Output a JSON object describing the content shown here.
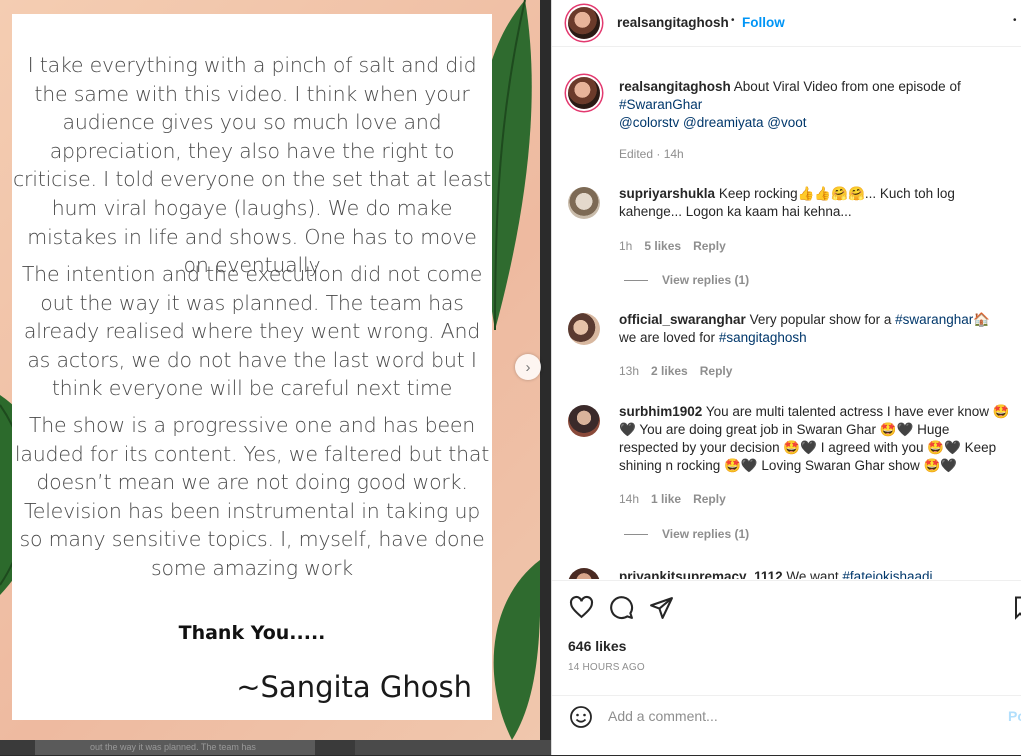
{
  "post": {
    "paragraphs": [
      "I take everything with a pinch of salt and did the same with this video. I think when your audience gives you so much love and appreciation, they also have the right to criticise. I told everyone on the set that at least hum viral hogaye (laughs). We do make mistakes in life and shows. One has to move on eventually",
      "The intention and the execution did not come out the way it was planned. The team has already realised where they went wrong. And as actors, we do not have the last word but I think everyone will be careful next time",
      "The show is a progressive one and has been lauded for its content. Yes, we faltered but that doesn’t mean we are not doing good work. Television has been instrumental in taking up so many sensitive topics. I, myself, have done some amazing work"
    ],
    "thanks": "Thank You.....",
    "signature": "~Sangita Ghosh",
    "next_icon": "chevron-right-icon",
    "strip_text": "out the way it was planned. The team has"
  },
  "header": {
    "username": "realsangitaghosh",
    "dot": "•",
    "follow": "Follow",
    "more": "•"
  },
  "caption": {
    "username": "realsangitaghosh",
    "text": "About Viral Video from one episode of",
    "hashtag": "#SwaranGhar",
    "mentions": [
      "@colorstv",
      "@dreamiyata",
      "@voot"
    ],
    "meta": "Edited · 14h"
  },
  "comments": [
    {
      "username": "supriyarshukla",
      "text": "Keep rocking👍👍🤗🤗... Kuch toh log kahenge... Logon ka kaam hai kehna...",
      "time": "1h",
      "likes": "5 likes",
      "reply": "Reply",
      "view_replies": "View replies (1)"
    },
    {
      "username": "official_swaranghar",
      "text_pre": "Very popular show for a",
      "hashtag1": "#swaranghar🏠",
      "text_mid": "we are loved for",
      "hashtag2": "#sangitaghosh",
      "time": "13h",
      "likes": "2 likes",
      "reply": "Reply"
    },
    {
      "username": "surbhim1902",
      "text": "You are multi talented actress I have ever know 🤩🖤 You are doing great job in Swaran Ghar 🤩🖤 Huge respected by your decision 🤩🖤 I agreed with you 🤩🖤 Keep shining n rocking 🤩🖤 Loving Swaran Ghar show 🤩🖤",
      "time": "14h",
      "likes": "1 like",
      "reply": "Reply",
      "view_replies": "View replies (1)"
    },
    {
      "username": "priyankitsupremacy_1112",
      "text": "We want",
      "hashtag": "#fateiokishaadi"
    }
  ],
  "actions": {
    "like_icon": "heart-icon",
    "comment_icon": "comment-icon",
    "share_icon": "share-icon",
    "save_icon": "bookmark-icon",
    "likes": "646 likes",
    "time": "14 HOURS AGO"
  },
  "add_comment": {
    "emoji_icon": "emoji-icon",
    "placeholder": "Add a comment...",
    "post": "Post"
  }
}
